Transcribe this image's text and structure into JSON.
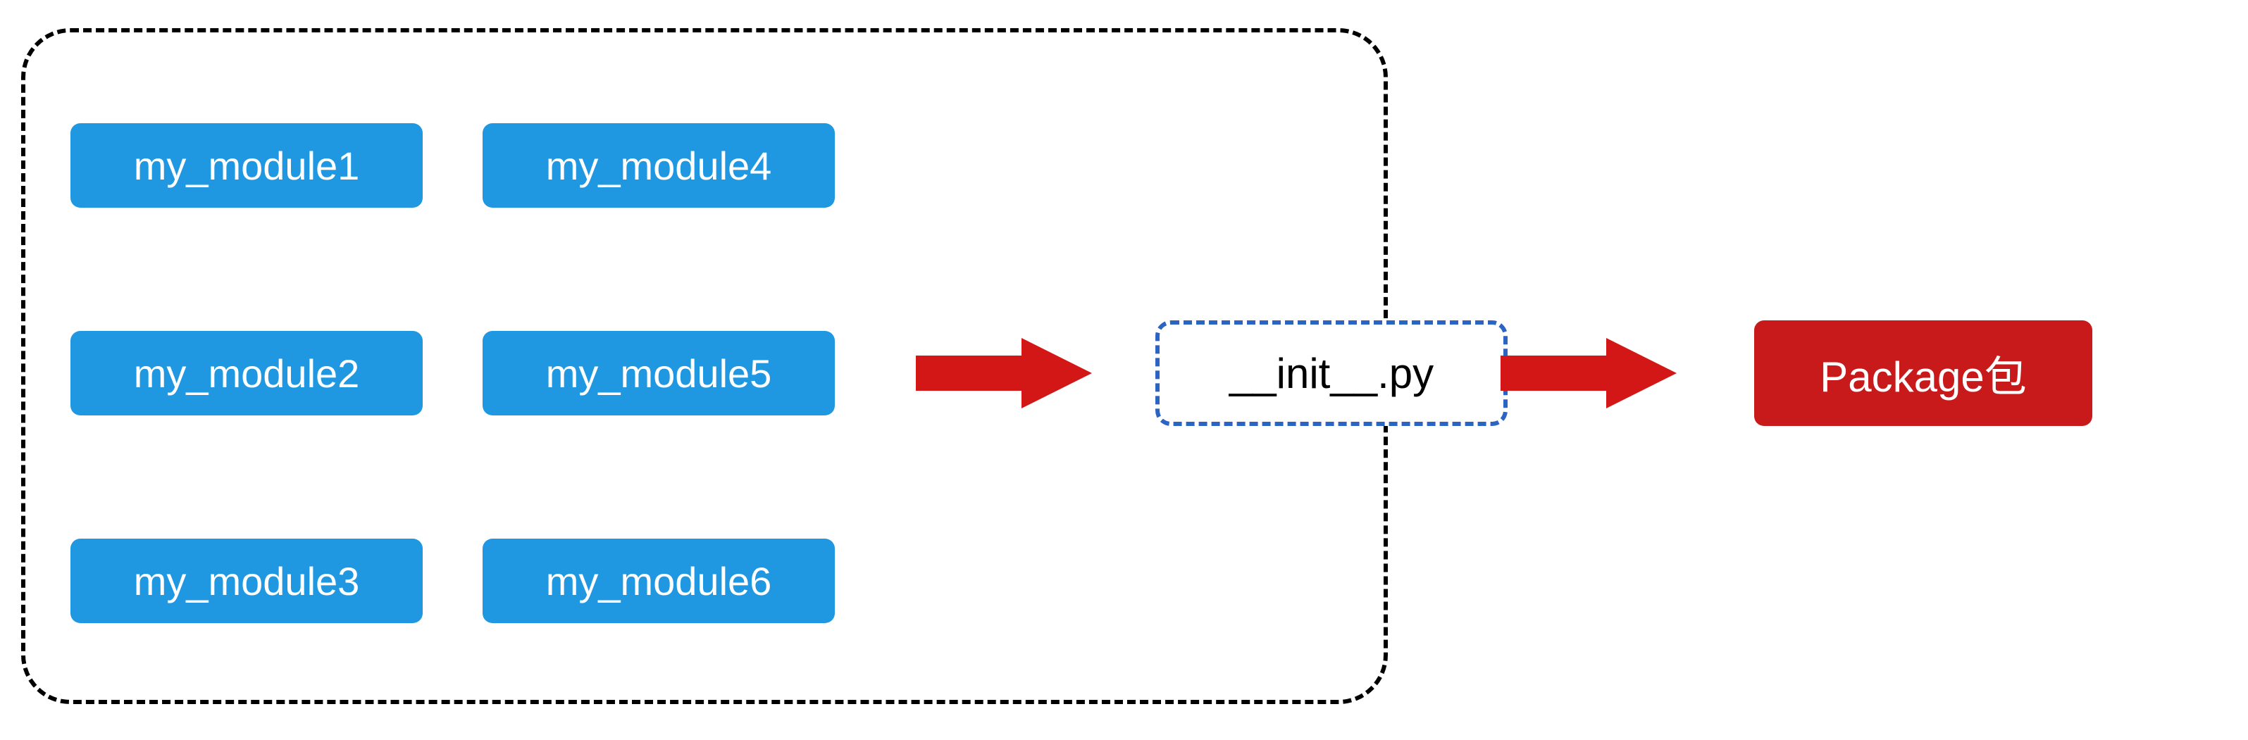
{
  "modules": {
    "m1": "my_module1",
    "m2": "my_module2",
    "m3": "my_module3",
    "m4": "my_module4",
    "m5": "my_module5",
    "m6": "my_module6"
  },
  "init_file": "__init__.py",
  "package_label": "Package包"
}
